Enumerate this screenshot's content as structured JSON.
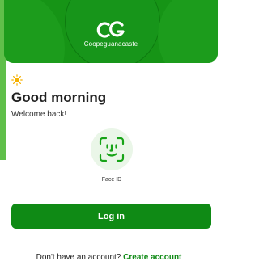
{
  "header": {
    "logo_letters": "CG",
    "brand_name": "Coopeguanacaste"
  },
  "greeting": {
    "icon": "sun-icon",
    "title": "Good morning",
    "subtitle": "Welcome back!"
  },
  "biometric": {
    "icon": "face-id-icon",
    "label": "Face ID"
  },
  "actions": {
    "login_label": "Log in",
    "signup_prompt": "Don't have an account?",
    "signup_link": "Create account"
  },
  "colors": {
    "brand_green": "#169416",
    "button_green": "#0f8a15",
    "sun": "#f5b000"
  }
}
